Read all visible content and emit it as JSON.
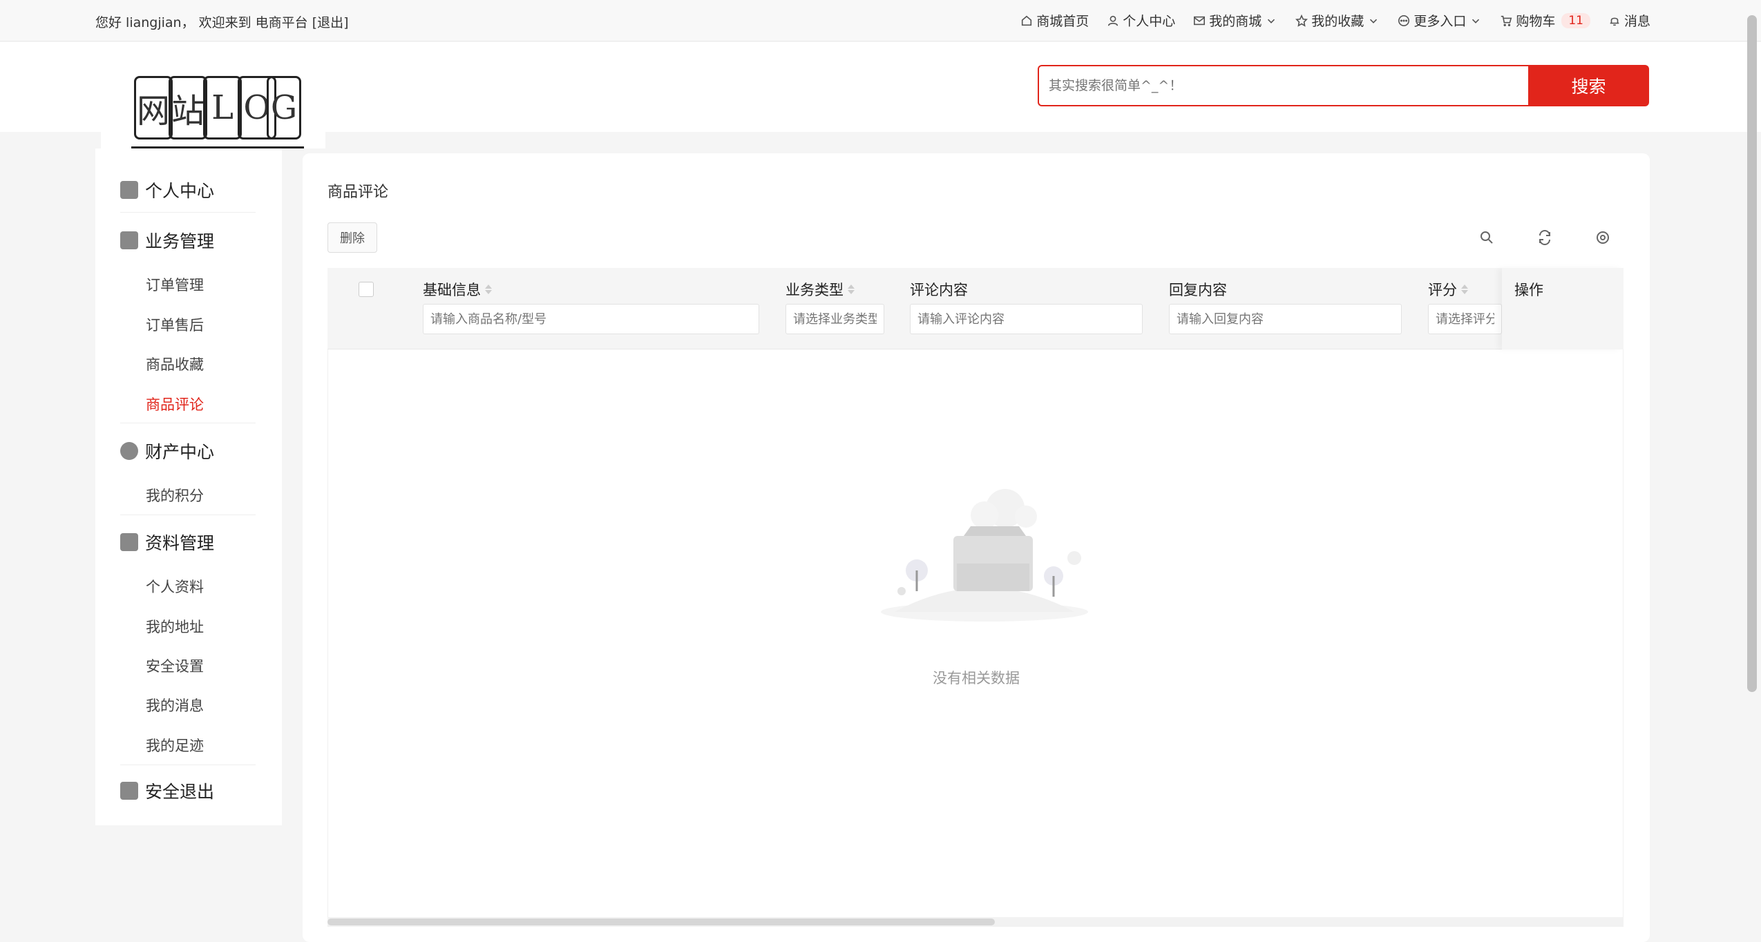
{
  "topbar": {
    "welcome": "您好 liangjian， 欢迎来到 电商平台 [退出]",
    "nav": [
      {
        "label": "商城首页",
        "icon": "home-icon"
      },
      {
        "label": "个人中心",
        "icon": "user-icon"
      },
      {
        "label": "我的商城",
        "icon": "mail-icon",
        "dropdown": true
      },
      {
        "label": "我的收藏",
        "icon": "star-icon",
        "dropdown": true
      },
      {
        "label": "更多入口",
        "icon": "more-icon",
        "dropdown": true
      },
      {
        "label": "购物车",
        "icon": "cart-icon",
        "badge": "11"
      },
      {
        "label": "消息",
        "icon": "bell-icon"
      }
    ]
  },
  "logo": {
    "letters": [
      "网",
      "站",
      "L",
      "O",
      "G"
    ]
  },
  "search": {
    "placeholder": "其实搜索很简单^_^！",
    "button": "搜索"
  },
  "sidebar": {
    "groups": [
      {
        "label": "个人中心",
        "icon": "user-icon",
        "items": []
      },
      {
        "label": "业务管理",
        "icon": "clipboard-icon",
        "items": [
          "订单管理",
          "订单售后",
          "商品收藏",
          "商品评论"
        ]
      },
      {
        "label": "财产中心",
        "icon": "wallet-icon",
        "items": [
          "我的积分"
        ]
      },
      {
        "label": "资料管理",
        "icon": "profile-icon",
        "items": [
          "个人资料",
          "我的地址",
          "安全设置",
          "我的消息",
          "我的足迹"
        ]
      },
      {
        "label": "安全退出",
        "icon": "logout-icon",
        "items": []
      }
    ],
    "active_item": "商品评论"
  },
  "main": {
    "title": "商品评论",
    "delete_button": "删除",
    "columns": [
      {
        "label": "基础信息",
        "sortable": true,
        "filter_placeholder": "请输入商品名称/型号"
      },
      {
        "label": "业务类型",
        "sortable": true,
        "filter_placeholder": "请选择业务类型"
      },
      {
        "label": "评论内容",
        "sortable": false,
        "filter_placeholder": "请输入评论内容"
      },
      {
        "label": "回复内容",
        "sortable": false,
        "filter_placeholder": "请输入回复内容"
      },
      {
        "label": "评分",
        "sortable": true,
        "filter_placeholder": "请选择评分"
      },
      {
        "label": "操作",
        "sortable": false,
        "filter_placeholder": ""
      }
    ],
    "empty_text": "没有相关数据"
  },
  "colors": {
    "accent": "#e1251b",
    "background": "#f5f5f5"
  }
}
